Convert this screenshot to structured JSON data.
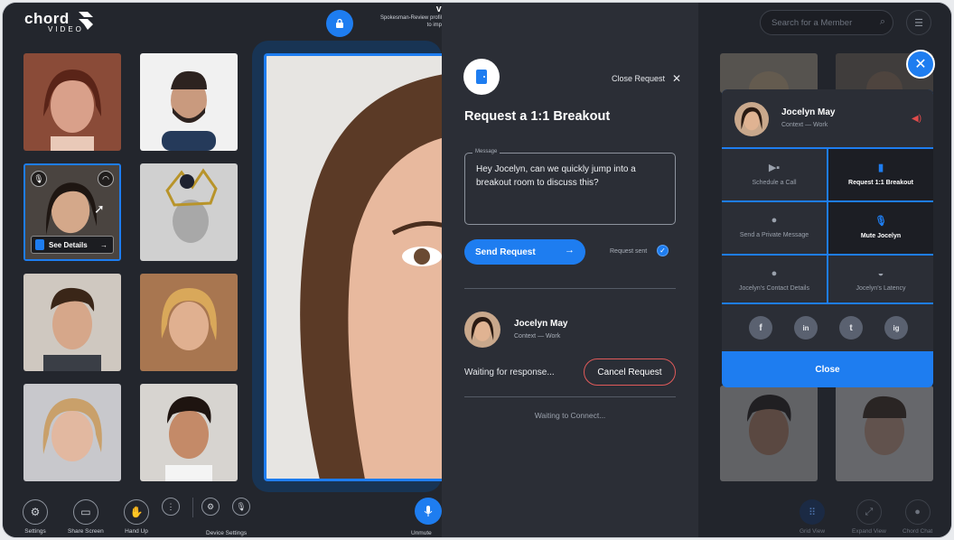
{
  "brand": {
    "name": "chord",
    "sub": "VIDEO"
  },
  "top": {
    "title": "V",
    "subtitle_1": "Spokesman-Review profil",
    "subtitle_2": "to imp"
  },
  "tiles": {
    "see_details": "See Details"
  },
  "controls": {
    "settings": "Settings",
    "share": "Share Screen",
    "hand": "Hand Up",
    "device": "Device Settings",
    "unmute": "Unmute"
  },
  "panel": {
    "close_request": "Close Request",
    "title": "Request a 1:1 Breakout",
    "message_label": "Message",
    "message": "Hey Jocelyn, can we quickly jump into a breakout room to discuss this?",
    "send": "Send Request",
    "request_sent": "Request sent",
    "person_name": "Jocelyn May",
    "person_context": "Context — Work",
    "waiting": "Waiting for response...",
    "cancel": "Cancel Request",
    "waiting_connect": "Waiting to Connect..."
  },
  "right": {
    "search_placeholder": "Search for a Member",
    "card_name": "Jocelyn May",
    "card_context": "Context — Work",
    "options": [
      "Schedule a Call",
      "Request 1:1 Breakout",
      "Send a Private Message",
      "Mute Jocelyn",
      "Jocelyn's Contact Details",
      "Jocelyn's Latency"
    ],
    "social": [
      "f",
      "in",
      "t",
      "ig"
    ],
    "close": "Close",
    "bottom": [
      "Grid View",
      "Expand View",
      "Chord Chat"
    ]
  },
  "colors": {
    "accent": "#1e7df0",
    "bg": "#23262d",
    "panel": "#2b2e36",
    "danger": "#e05a5a"
  }
}
